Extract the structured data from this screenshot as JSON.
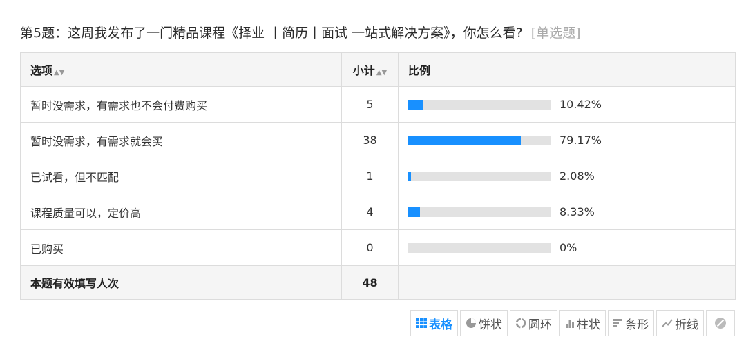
{
  "question": {
    "title": "第5题：这周我发布了一门精品课程《择业 丨简历丨面试 一站式解决方案》，你怎么看?",
    "type_label": "[单选题]"
  },
  "table": {
    "headers": {
      "option": "选项",
      "count": "小计",
      "ratio": "比例"
    },
    "rows": [
      {
        "option": "暂时没需求，有需求也不会付费购买",
        "count": "5",
        "percent": "10.42%",
        "ratio": 0.1042
      },
      {
        "option": "暂时没需求，有需求就会买",
        "count": "38",
        "percent": "79.17%",
        "ratio": 0.7917
      },
      {
        "option": "已试看，但不匹配",
        "count": "1",
        "percent": "2.08%",
        "ratio": 0.0208
      },
      {
        "option": "课程质量可以，定价高",
        "count": "4",
        "percent": "8.33%",
        "ratio": 0.0833
      },
      {
        "option": "已购买",
        "count": "0",
        "percent": "0%",
        "ratio": 0
      }
    ],
    "total": {
      "label": "本题有效填写人次",
      "count": "48"
    }
  },
  "toolbar": {
    "table": "表格",
    "pie": "饼状",
    "ring": "圆环",
    "column": "柱状",
    "bar": "条形",
    "line": "折线"
  },
  "colors": {
    "accent": "#1890ff",
    "track": "#e2e2e2"
  }
}
